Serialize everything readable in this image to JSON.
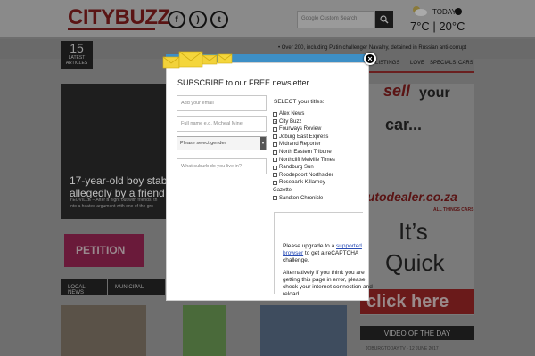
{
  "header": {
    "logo": "CITYBUZZ",
    "social": [
      {
        "icon": "facebook-icon",
        "glyph": "f"
      },
      {
        "icon": "rss-icon",
        "glyph": ")"
      },
      {
        "icon": "twitter-icon",
        "glyph": "t"
      }
    ],
    "search_placeholder": "Google Custom Search",
    "weather": {
      "today_label": "TODAY",
      "temps": "7°C | 20°C"
    }
  },
  "ticker": {
    "count": "15",
    "count_label_1": "LATEST",
    "count_label_2": "ARTICLES",
    "headline": "• Over 200, including Putin challenger Navalny, detained in Russian anti-corrupt"
  },
  "nav": [
    "LESS LISTINGS",
    "LOVE",
    "SPECIALS",
    "CARS"
  ],
  "story": {
    "title_1": "17-year-old boy stab",
    "title_2": "allegedly by a friend",
    "sub_1": "YEOVILLE – After a night out with friends, th",
    "sub_2": "into a heated argument with one of the gro"
  },
  "petition_label": "PETITION",
  "tabs": [
    "LOCAL NEWS",
    "MUNICIPAL"
  ],
  "ad": {
    "sell": "sell",
    "your": "your",
    "car": "car...",
    "dealer": "autodealer.co.za",
    "dealer_sub": "ALL THINGS CARS",
    "its": "It’s",
    "quick": "Quick",
    "click": "click here"
  },
  "video": {
    "label": "VIDEO OF THE DAY",
    "meta": "JOBURGTODAY.TV - 12 JUNE 2017"
  },
  "modal": {
    "title": "SUBSCRIBE to our FREE newsletter",
    "email_placeholder": "Add your email",
    "name_placeholder": "Full name e.g. Micheal Mine",
    "gender_select": "Please select gender",
    "suburb_placeholder": "What suburb do you live in?",
    "titles_label": "SELECT your titles:",
    "titles": [
      {
        "label": "Alex News",
        "checked": false
      },
      {
        "label": "City Buzz",
        "checked": true
      },
      {
        "label": "Fourways Review",
        "checked": false
      },
      {
        "label": "Joburg East Express",
        "checked": false
      },
      {
        "label": "Midrand Reporter",
        "checked": false
      },
      {
        "label": "North Eastern Tribune",
        "checked": false
      },
      {
        "label": "Northcliff Melville Times",
        "checked": false
      },
      {
        "label": "Randburg Sun",
        "checked": false
      },
      {
        "label": "Roodepoort Northsider",
        "checked": false
      },
      {
        "label": "Rosebank Killarney",
        "checked": false
      },
      {
        "label": "Gazette",
        "checked": null
      },
      {
        "label": "Sandton Chronicle",
        "checked": false
      }
    ],
    "captcha": {
      "line1_pre": "Please upgrade to a ",
      "line1_link": "supported",
      "line2_link": "browser",
      "line2_post": " to get a reCAPTCHA",
      "line3": "challenge.",
      "line4": "Alternatively if you think you are",
      "line5": "getting this page in error, please",
      "line6": "check your internet connection and",
      "line7": "reload."
    }
  }
}
